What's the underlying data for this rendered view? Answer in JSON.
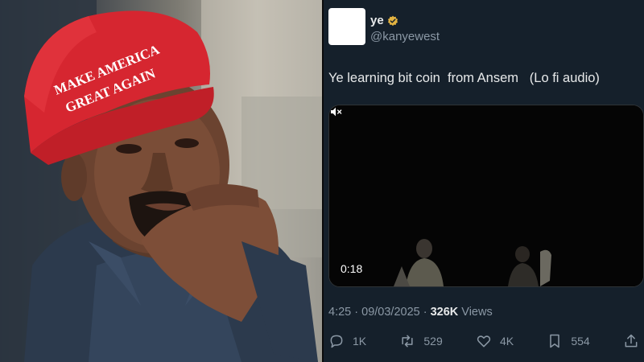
{
  "photo": {
    "cap_text_line1": "MAKE AMERICA",
    "cap_text_line2": "GREAT AGAIN"
  },
  "tweet": {
    "display_name": "ye",
    "handle": "@kanyewest",
    "text": "Ye learning bit coin  from Ansem   (Lo fi audio)",
    "video": {
      "time": "0:18",
      "icon": "mute-icon"
    },
    "meta": {
      "time": "4:25",
      "date": "09/03/2025",
      "separator": " · ",
      "views_count": "326K",
      "views_label": " Views"
    },
    "actions": {
      "replies": "1K",
      "reposts": "529",
      "likes": "4K",
      "bookmarks": "554"
    }
  },
  "colors": {
    "background": "#15202b",
    "text": "#e7e9ea",
    "muted": "#8b98a5",
    "verified": "#e3b341",
    "cap_red": "#d62630"
  }
}
